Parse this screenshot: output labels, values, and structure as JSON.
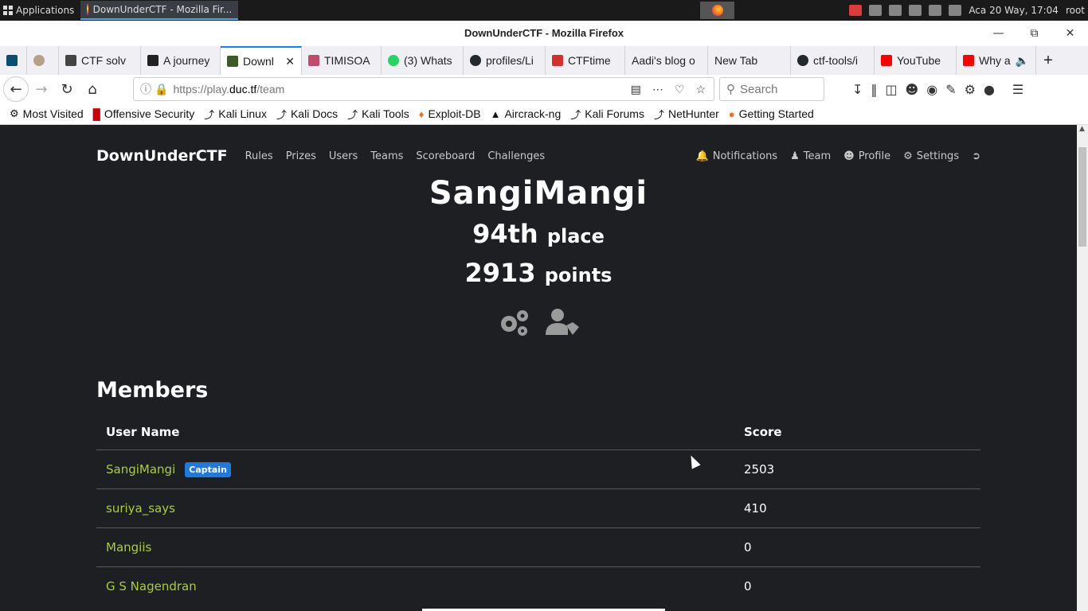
{
  "taskbar": {
    "applications_label": "Applications",
    "active_task": "DownUnderCTF - Mozilla Fir...",
    "datetime": "Aca 20 Way, 17:04",
    "user": "root"
  },
  "window": {
    "title": "DownUnderCTF - Mozilla Firefox"
  },
  "tabs": [
    {
      "label": "",
      "icon": "kali-icon",
      "color": "#0a4d6e"
    },
    {
      "label": "",
      "icon": "pinned-icon",
      "color": "#b5a08a"
    },
    {
      "label": "CTF solv",
      "icon": "doc-icon",
      "color": "#444"
    },
    {
      "label": "A journey",
      "icon": "mb-icon",
      "color": "#222"
    },
    {
      "label": "Downl",
      "icon": "ductf-icon",
      "color": "#3d5a2a",
      "active": true
    },
    {
      "label": "TIMISOA",
      "icon": "plant-icon",
      "color": "#c04b6a"
    },
    {
      "label": "(3) Whats",
      "icon": "whatsapp-icon",
      "color": "#25d366"
    },
    {
      "label": "profiles/Li",
      "icon": "github-icon",
      "color": "#24292e"
    },
    {
      "label": "CTFtime",
      "icon": "ctftime-icon",
      "color": "#d62d2d"
    },
    {
      "label": "Aadi's blog o",
      "icon": "none",
      "color": "transparent"
    },
    {
      "label": "New Tab",
      "icon": "none",
      "color": "transparent"
    },
    {
      "label": "ctf-tools/i",
      "icon": "github-icon",
      "color": "#24292e"
    },
    {
      "label": "YouTube",
      "icon": "youtube-icon",
      "color": "#ff0000"
    },
    {
      "label": "Why a",
      "icon": "youtube-icon",
      "color": "#ff0000"
    }
  ],
  "address": {
    "prefix": "https://play.",
    "host": "duc.tf",
    "path": "/team"
  },
  "search": {
    "placeholder": "Search"
  },
  "bookmarks": [
    {
      "label": "Most Visited",
      "icon": "gear-icon"
    },
    {
      "label": "Offensive Security",
      "icon": "offsec-icon"
    },
    {
      "label": "Kali Linux",
      "icon": "kali-icon"
    },
    {
      "label": "Kali Docs",
      "icon": "kali-icon"
    },
    {
      "label": "Kali Tools",
      "icon": "kali-icon"
    },
    {
      "label": "Exploit-DB",
      "icon": "exploitdb-icon"
    },
    {
      "label": "Aircrack-ng",
      "icon": "aircrack-icon"
    },
    {
      "label": "Kali Forums",
      "icon": "kali-icon"
    },
    {
      "label": "NetHunter",
      "icon": "kali-icon"
    },
    {
      "label": "Getting Started",
      "icon": "firefox-icon"
    }
  ],
  "site": {
    "brand": "DownUnderCTF",
    "nav": [
      "Rules",
      "Prizes",
      "Users",
      "Teams",
      "Scoreboard",
      "Challenges"
    ],
    "nav_right": [
      "Notifications",
      "Team",
      "Profile",
      "Settings"
    ]
  },
  "team": {
    "name": "SangiMangi",
    "place": "94th",
    "place_suffix": "place",
    "points": "2913",
    "points_suffix": "points"
  },
  "members": {
    "title": "Members",
    "col_name": "User Name",
    "col_score": "Score",
    "captain_badge": "Captain",
    "rows": [
      {
        "name": "SangiMangi",
        "score": "2503",
        "captain": true
      },
      {
        "name": "suriya_says",
        "score": "410"
      },
      {
        "name": "Mangiis",
        "score": "0"
      },
      {
        "name": "G S Nagendran",
        "score": "0"
      }
    ]
  },
  "colors": {
    "page_bg": "#1e1f22",
    "member_link": "#a8ce3a",
    "captain_badge": "#1f7ae0"
  }
}
